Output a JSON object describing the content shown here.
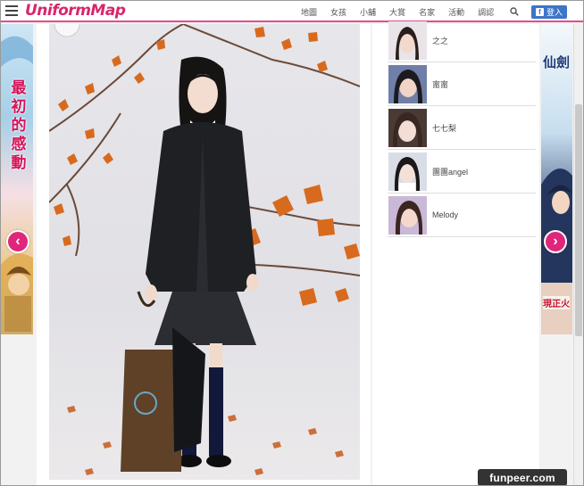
{
  "header": {
    "logo_text": "UniformMap",
    "nav": [
      "地圖",
      "女孩",
      "小舖",
      "大賞",
      "名家",
      "活動",
      "調認"
    ],
    "login_label": "登入",
    "login_icon": "f",
    "brand_color": "#d9256b",
    "accent_color": "#e24d8e"
  },
  "left_banner": {
    "text": "最初的感動"
  },
  "right_banner": {
    "text": "仙劍",
    "subtext": "現正火"
  },
  "arrows": {
    "prev": "‹",
    "next": "›"
  },
  "members": [
    {
      "name": "之之"
    },
    {
      "name": "甯甯"
    },
    {
      "name": "七七梨"
    },
    {
      "name": "團團angel"
    },
    {
      "name": "Melody"
    }
  ],
  "watermark": "funpeer.com"
}
